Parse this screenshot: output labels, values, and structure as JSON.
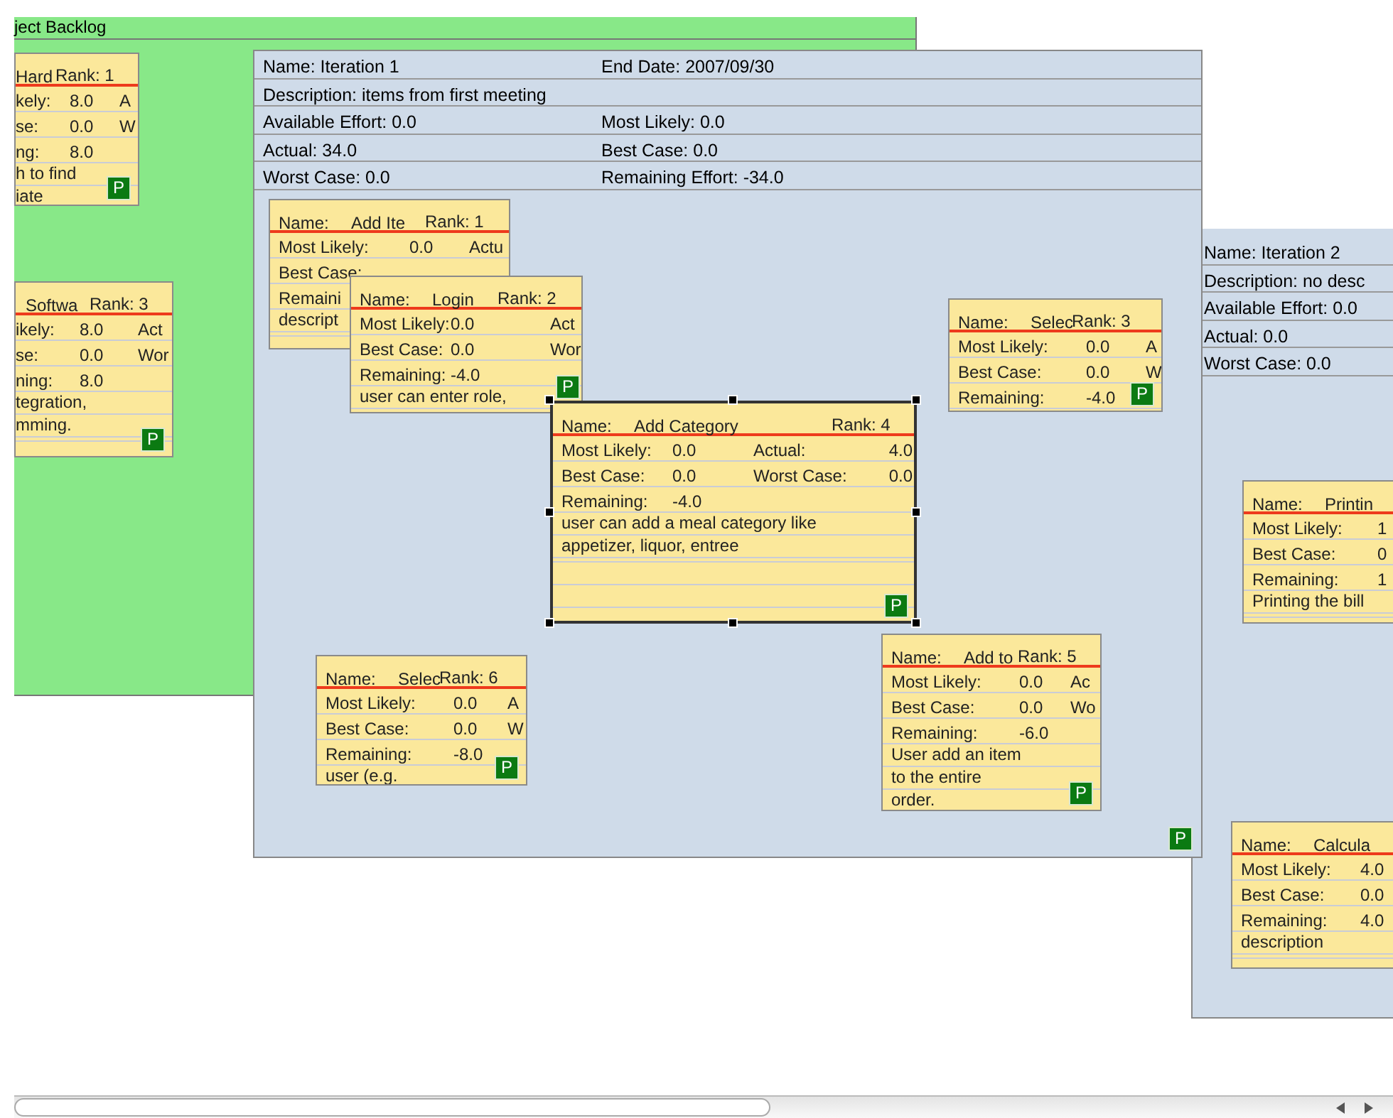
{
  "windows": [
    {
      "kind": "backlog",
      "title": "ject Backlog",
      "cards": [
        {
          "name": "Hard",
          "rank": "Rank: 1",
          "rows": [
            [
              "kely:",
              "8.0",
              "A"
            ],
            [
              "se:",
              "0.0",
              "W"
            ],
            [
              "ng:",
              "8.0"
            ]
          ],
          "description": [
            "h to find",
            "iate"
          ],
          "badge": "P",
          "selected": false
        },
        {
          "name": "Softwa",
          "rank": "Rank: 3",
          "rows": [
            [
              "ikely:",
              "8.0",
              "Act"
            ],
            [
              "se:",
              "0.0",
              "Wor"
            ],
            [
              "ning:",
              "8.0"
            ]
          ],
          "description": [
            "tegration,",
            "mming."
          ],
          "badge": "P",
          "selected": false
        }
      ]
    },
    {
      "kind": "iteration",
      "header_rows": [
        [
          "Name: Iteration 2"
        ],
        [
          "Description: no desc"
        ],
        [
          "Available Effort: 0.0"
        ],
        [
          "Actual: 0.0"
        ],
        [
          "Worst Case: 0.0"
        ]
      ],
      "cards": [
        {
          "name_label": "Name:",
          "name": "Printin",
          "rows": [
            [
              "Most Likely:",
              "1"
            ],
            [
              "Best Case:",
              "0"
            ],
            [
              "Remaining:",
              "1"
            ]
          ],
          "description": [
            "Printing the bill"
          ],
          "selected": false
        },
        {
          "name_label": "Name:",
          "name": "Calcula",
          "rows": [
            [
              "Most Likely:",
              "4.0"
            ],
            [
              "Best Case:",
              "0.0"
            ],
            [
              "Remaining:",
              "4.0"
            ]
          ],
          "description": [
            "description"
          ],
          "selected": false
        }
      ]
    },
    {
      "kind": "iteration",
      "header_rows": [
        [
          "Name: Iteration 1",
          "End Date: 2007/09/30"
        ],
        [
          "Description: items from first meeting"
        ],
        [
          "Available Effort: 0.0",
          "Most Likely: 0.0"
        ],
        [
          "Actual: 34.0",
          "Best Case: 0.0"
        ],
        [
          "Worst Case: 0.0",
          "Remaining Effort: -34.0"
        ]
      ],
      "badge": "P",
      "cards": [
        {
          "name_label": "Name:",
          "name": "Add Ite",
          "rank": "Rank: 1",
          "rows": [
            [
              "Most Likely:",
              "0.0",
              "Actu"
            ],
            [
              "Best Case:"
            ],
            [
              "Remaini"
            ]
          ],
          "description": [
            "descript"
          ],
          "selected": false
        },
        {
          "name_label": "Name:",
          "name": "Login",
          "rank": "Rank: 2",
          "rows": [
            [
              "Most Likely:",
              "0.0",
              "Act"
            ],
            [
              "Best Case:",
              "0.0",
              "Wor"
            ],
            [
              "Remaining:",
              "-4.0"
            ]
          ],
          "description": [
            "user can enter role,"
          ],
          "badge": "P",
          "selected": false
        },
        {
          "name_label": "Name:",
          "name": "Add Category",
          "rank": "Rank: 4",
          "rows": [
            [
              "Most Likely:",
              "0.0",
              "Actual:",
              "4.0"
            ],
            [
              "Best Case:",
              "0.0",
              "Worst Case:",
              "0.0"
            ],
            [
              "Remaining:",
              "-4.0"
            ]
          ],
          "description": [
            "user can add a meal category like",
            "appetizer, liquor, entree"
          ],
          "badge": "P",
          "selected": true
        },
        {
          "name_label": "Name:",
          "name": "Selec",
          "rank": "Rank: 3",
          "rows": [
            [
              "Most Likely:",
              "0.0",
              "A"
            ],
            [
              "Best Case:",
              "0.0",
              "W"
            ],
            [
              "Remaining:",
              "-4.0"
            ]
          ],
          "badge": "P",
          "selected": false
        },
        {
          "name_label": "Name:",
          "name": "Selec",
          "rank": "Rank: 6",
          "rows": [
            [
              "Most Likely:",
              "0.0",
              "A"
            ],
            [
              "Best Case:",
              "0.0",
              "W"
            ],
            [
              "Remaining:",
              "-8.0"
            ]
          ],
          "description": [
            "user (e.g."
          ],
          "badge": "P",
          "selected": false
        },
        {
          "name_label": "Name:",
          "name": "Add to",
          "rank": "Rank: 5",
          "rows": [
            [
              "Most Likely:",
              "0.0",
              "Ac"
            ],
            [
              "Best Case:",
              "0.0",
              "Wo"
            ],
            [
              "Remaining:",
              "-6.0"
            ]
          ],
          "description": [
            "User add an item",
            "to the entire",
            "order."
          ],
          "badge": "P",
          "selected": false
        }
      ]
    }
  ]
}
